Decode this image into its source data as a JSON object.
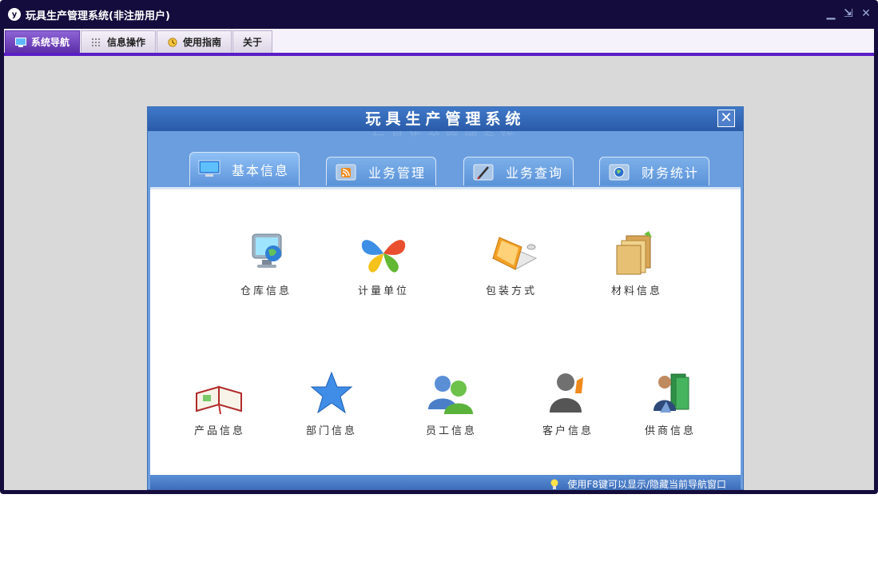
{
  "window": {
    "title": "玩具生产管理系统(非注册用户)",
    "logo_glyph": "y",
    "controls": {
      "minimize": "▁",
      "restore": "⇲",
      "close": "✕"
    }
  },
  "menubar": {
    "tabs": [
      {
        "label": "系统导航",
        "icon": "monitor-icon",
        "active": true
      },
      {
        "label": "信息操作",
        "icon": "grid-icon",
        "active": false
      },
      {
        "label": "使用指南",
        "icon": "clock-icon",
        "active": false
      },
      {
        "label": "关于",
        "icon": "",
        "active": false
      }
    ]
  },
  "dialog": {
    "title": "玩具生产管理系统",
    "close_glyph": "✕",
    "category_tabs": [
      {
        "label": "基本信息",
        "icon": "monitor-icon",
        "active": true
      },
      {
        "label": "业务管理",
        "icon": "rss-folder-icon",
        "active": false
      },
      {
        "label": "业务查询",
        "icon": "pen-folder-icon",
        "active": false
      },
      {
        "label": "财务统计",
        "icon": "globe-folder-icon",
        "active": false
      }
    ],
    "modules": [
      {
        "label": "仓库信息",
        "icon": "globe-monitor-icon"
      },
      {
        "label": "计量单位",
        "icon": "butterfly-icon"
      },
      {
        "label": "包装方式",
        "icon": "laptop-icon"
      },
      {
        "label": "材料信息",
        "icon": "folders-icon"
      },
      {
        "label": "产品信息",
        "icon": "open-book-icon"
      },
      {
        "label": "部门信息",
        "icon": "star-icon"
      },
      {
        "label": "员工信息",
        "icon": "users-icon"
      },
      {
        "label": "客户信息",
        "icon": "customer-icon"
      },
      {
        "label": "供商信息",
        "icon": "supplier-icon"
      }
    ],
    "status": {
      "hint": "使用F8键可以显示/隐藏当前导航窗口"
    }
  },
  "colors": {
    "frame": "#140c3c",
    "menu_accent": "#5a1ec6",
    "dialog_blue": "#6b9ede",
    "workspace": "#d9d9d9"
  }
}
